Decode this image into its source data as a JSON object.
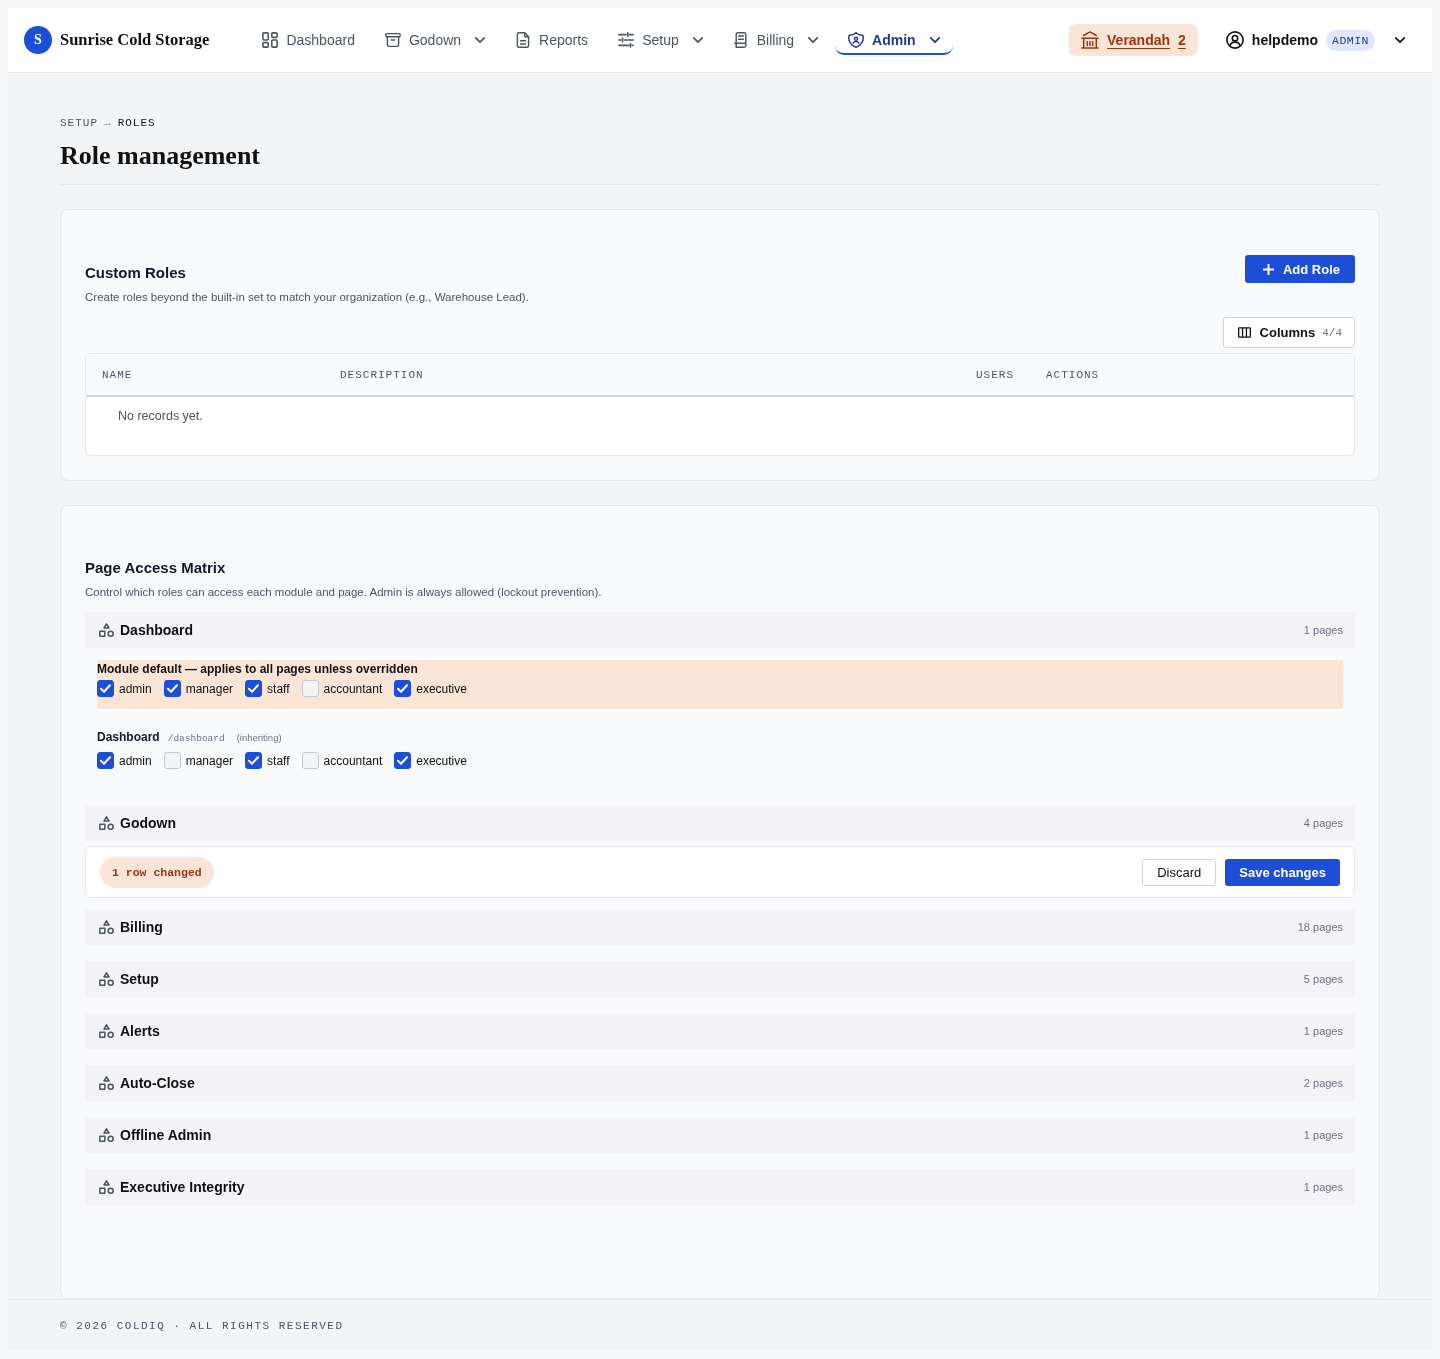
{
  "header": {
    "logo_letter": "S",
    "brand": "Sunrise Cold Storage",
    "nav": [
      {
        "label": "Dashboard",
        "has_menu": false,
        "selected": false
      },
      {
        "label": "Godown",
        "has_menu": true,
        "selected": false
      },
      {
        "label": "Reports",
        "has_menu": false,
        "selected": false
      },
      {
        "label": "Setup",
        "has_menu": true,
        "selected": false
      },
      {
        "label": "Billing",
        "has_menu": true,
        "selected": false
      },
      {
        "label": "Admin",
        "has_menu": true,
        "selected": true
      }
    ],
    "location": {
      "label": "Verandah",
      "count": "2"
    },
    "user": {
      "name": "helpdemo",
      "role": "ADMIN"
    }
  },
  "breadcrumb": {
    "items": [
      "SETUP",
      "ROLES"
    ],
    "separator": "→"
  },
  "title": "Role management",
  "custom_roles": {
    "title": "Custom Roles",
    "subtitle": "Create roles beyond the built-in set to match your organization (e.g., Warehouse Lead).",
    "add_button": "Add Role",
    "columns_button": {
      "label": "Columns",
      "count": "4/4"
    },
    "table": {
      "columns": [
        "NAME",
        "DESCRIPTION",
        "USERS",
        "ACTIONS"
      ],
      "empty_text": "No records yet."
    }
  },
  "access_matrix": {
    "title": "Page Access Matrix",
    "subtitle": "Control which roles can access each module and page. Admin is always allowed (lockout prevention).",
    "rows": [
      {
        "kind": "module",
        "name": "Dashboard",
        "pages_count": "1 pages",
        "default": {
          "label": "Module default — applies to all pages unless overridden",
          "roles": [
            {
              "name": "admin",
              "checked": true
            },
            {
              "name": "manager",
              "checked": true
            },
            {
              "name": "staff",
              "checked": true
            },
            {
              "name": "accountant",
              "checked": false
            },
            {
              "name": "executive",
              "checked": true
            }
          ]
        },
        "pages": [
          {
            "name": "Dashboard",
            "path": "/dashboard",
            "status": "(inheriting)",
            "roles": [
              {
                "name": "admin",
                "checked": true
              },
              {
                "name": "manager",
                "checked": false
              },
              {
                "name": "staff",
                "checked": true
              },
              {
                "name": "accountant",
                "checked": false
              },
              {
                "name": "executive",
                "checked": true
              }
            ]
          }
        ]
      },
      {
        "kind": "module",
        "name": "Godown",
        "pages_count": "4 pages"
      },
      {
        "kind": "save_bar",
        "changes": "1 row changed",
        "discard": "Discard",
        "save": "Save changes"
      },
      {
        "kind": "module",
        "name": "Billing",
        "pages_count": "18 pages"
      },
      {
        "kind": "module",
        "name": "Setup",
        "pages_count": "5 pages"
      },
      {
        "kind": "module",
        "name": "Alerts",
        "pages_count": "1 pages"
      },
      {
        "kind": "module",
        "name": "Auto-Close",
        "pages_count": "2 pages"
      },
      {
        "kind": "module",
        "name": "Offline Admin",
        "pages_count": "1 pages"
      },
      {
        "kind": "module",
        "name": "Executive Integrity",
        "pages_count": "1 pages"
      }
    ]
  },
  "footer": "© 2026 COLDIQ · ALL RIGHTS RESERVED"
}
